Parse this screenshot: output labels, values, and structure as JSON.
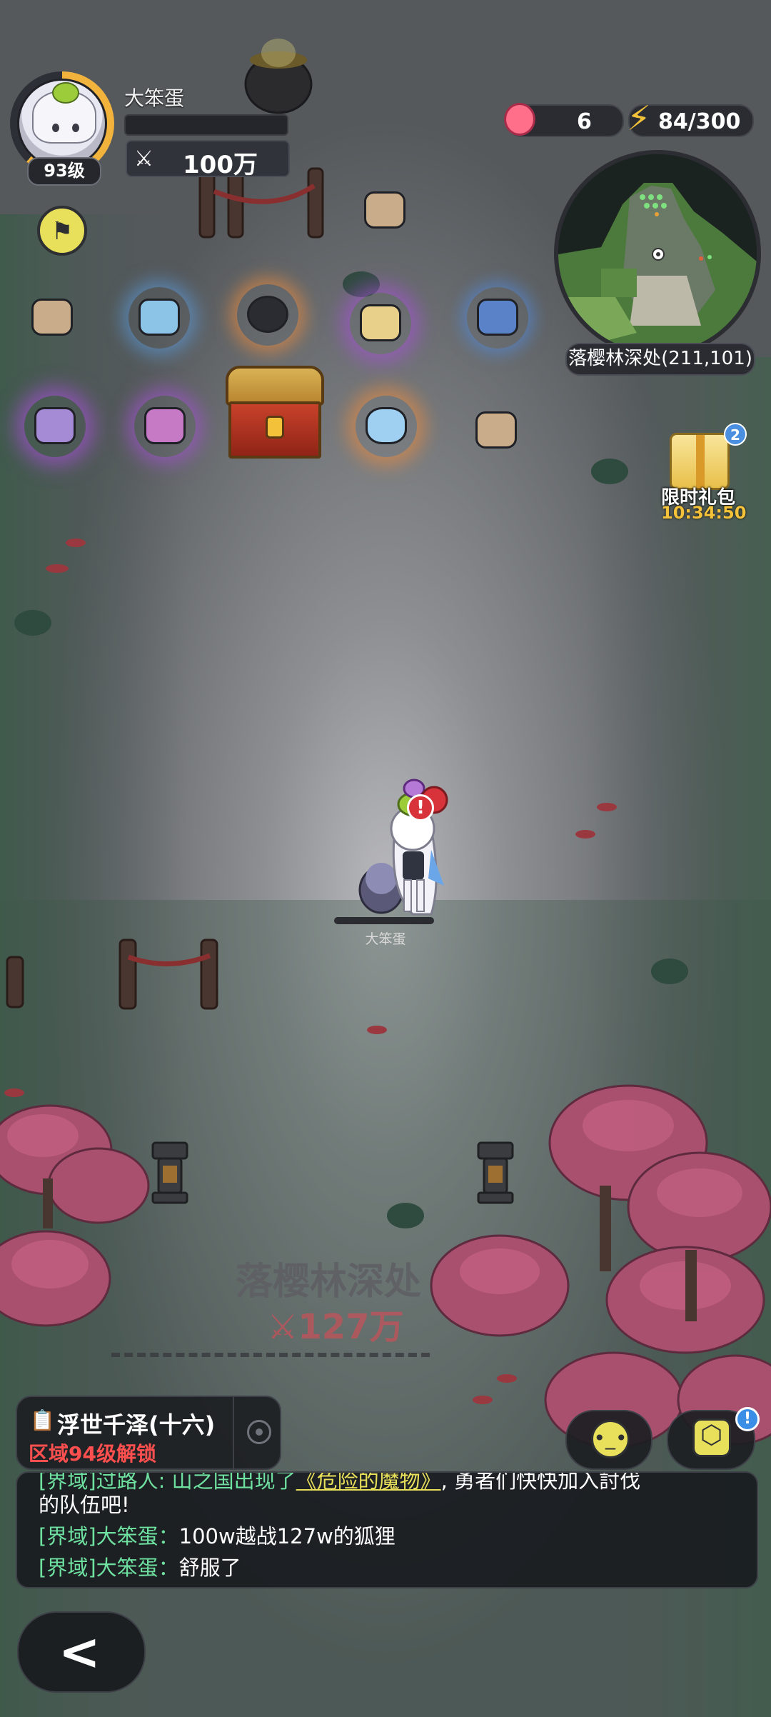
{
  "player": {
    "name": "大笨蛋",
    "level": "93级",
    "power": "100万",
    "exp_fraction": 0.0
  },
  "resources": {
    "apples": "6",
    "energy": "84/300"
  },
  "minimap": {
    "location_label": "落樱林深处(211,101)"
  },
  "gift": {
    "label": "限时礼包",
    "timer": "10:34:50",
    "badge": "2"
  },
  "character": {
    "name": "大笨蛋",
    "alert": "!"
  },
  "zone": {
    "title": "落樱林深处",
    "power": "127万"
  },
  "quest": {
    "title": "浮世千泽(十六)",
    "lock_text": "区域94级解锁"
  },
  "chat": {
    "partial": "[界域]过路人: 山之国出现了《危险的魔物》, 勇者们快快加入討伐的队伍吧!",
    "partial_prefix": "[界域]过路人: 山之国出现了",
    "partial_highlight": "《危险的魔物》",
    "partial_suffix": ", 勇者们快快加入討伐",
    "partial_line2": "的队伍吧!",
    "lines": [
      {
        "tag": "[界域]大笨蛋：",
        "text": "100w越战127w的狐狸"
      },
      {
        "tag": "[界域]大笨蛋：",
        "text": "舒服了"
      }
    ]
  },
  "buttons": {
    "back": "<",
    "info": "!",
    "emoji": "😐"
  },
  "icons": {
    "power": "crossed-swords-icon",
    "flag": "flag-icon",
    "apple": "apple-icon",
    "energy": "lightning-icon"
  },
  "colors": {
    "accent_yellow": "#e8e05a",
    "lock_red": "#ff4f4f",
    "chat_tag_green": "#6ee0a0",
    "timer_gold": "#f4c23a"
  }
}
